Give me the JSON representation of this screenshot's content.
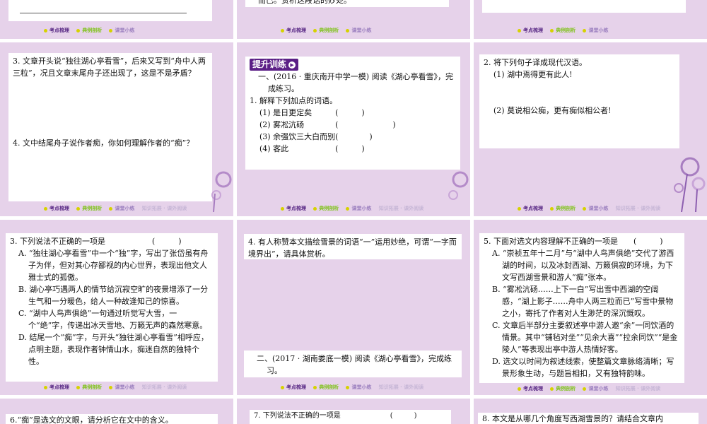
{
  "nav": {
    "t1": "考点梳理",
    "t2": "典例剖析",
    "t3": "课堂小练",
    "t4": "知识拓展 · 课外阅读"
  },
  "top": {
    "s1": "——————————————————",
    "s2": "而已。赏析这段话的妙处。"
  },
  "mid": {
    "a_q3": "3. 文章开头说“独往湖心亭看雪”，后来又写到“舟中人两三粒”，况且文章末尾舟子还出现了，这是不是矛盾？",
    "a_q4": "4. 文中结尾舟子说作者痴，你如何理解作者的“痴”？",
    "b_badge": "提升训练",
    "b_intro": "一、(2016 · 重庆南开中学一模) 阅读《湖心亭看雪》，完成练习。",
    "b_q1": "1. 解释下列加点的词语。",
    "b_items": [
      "(1) 是日更定矣　　　(　　　)",
      "(2) 雾凇沆砀　　　　(　　　　　　　)",
      "(3) 余强饮三大白而别(　　　　)",
      "(4) 客此　　　　　　(　　　)"
    ],
    "c_q2": "2. 将下列句子译成现代汉语。",
    "c_i1": "(1) 湖中焉得更有此人!",
    "c_i2": "(2) 莫说相公痴，更有痴似相公者!"
  },
  "bottom": {
    "a_q": "3. 下列说法不正确的一项是　　　　　　(　　　)",
    "a_opts": [
      "A. “独往湖心亭看雪”中一个“独”字，写出了张岱虽有舟子为伴，但对其心存鄙视的内心世界，表现出他文人雅士式的孤傲。",
      "B. 湖心亭巧遇两人的情节给沉寂空旷的夜景增添了一分生气和一分暖色，给人一种故逢知己的惊喜。",
      "C. “湖中人鸟声俱绝”一句通过听觉写大雪，一个“绝”字，传递出冰天雪地、万籁无声的森然寒意。",
      "D. 结尾一个“痴”字，与开头“独往湖心亭看雪”相呼应，点明主题，表现作者钟情山水，痴迷自然的独特个性。"
    ],
    "b_q": "4. 有人称赞本文描绘雪景的词语“一”运用妙绝，可谓“一字而境界出”，请具体赏析。",
    "b_intro2": "二、(2017 · 湖南娄底一模) 阅读《湖心亭看雪》，完成练习。",
    "c_q": "5. 下面对选文内容理解不正确的一项是　　(　　　)",
    "c_opts": [
      "A. “崇祯五年十二月”与“湖中人鸟声俱绝”交代了游西湖的时间，以及冰封西湖、万籁俱寂的环境，为下文写西湖雪景和游人“痴”张本。",
      "B. “雾凇沆砀……上下一白”写出雪中西湖的空阔感，“湖上影子……舟中人两三粒而已”写雪中景物之小，寄托了作者对人生渺茫的深沉慨叹。",
      "C. 文章后半部分主要叙述亭中游人邀“余”一同饮酒的情景。其中“铺毡对坐”“见余大喜”“拉余同饮”“是金陵人”等表现出亭中游人热情好客。",
      "D. 选文以时间为叙述线索，使整篇文章脉络清晰；写景形象生动，与题旨相扣，又有独特韵味。"
    ]
  },
  "last": {
    "a": "6.“痴”是选文的文眼，请分析它在文中的含义。",
    "b": "7. 下列说法不正确的一项是　　　　　　　(　　　)",
    "c": "8. 本文是从哪几个角度写西湖雪景的？请结合文章内"
  },
  "colors": {
    "slide_bg": "#e6d2ea",
    "accent_purple": "#5b1f86",
    "nav_dot": "#d6d200",
    "nav_green": "#7fc21a"
  }
}
